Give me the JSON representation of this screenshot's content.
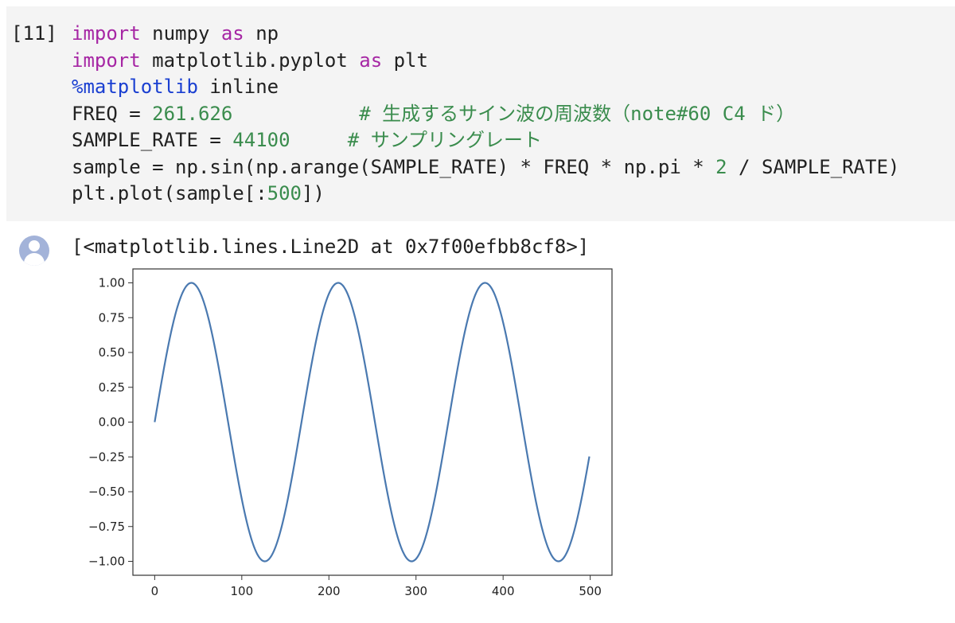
{
  "cell": {
    "execution_count": "[11]",
    "code_lines": [
      [
        {
          "t": "import",
          "c": "kw"
        },
        {
          "t": " numpy "
        },
        {
          "t": "as",
          "c": "kw"
        },
        {
          "t": " np"
        }
      ],
      [
        {
          "t": "import",
          "c": "kw"
        },
        {
          "t": " matplotlib.pyplot "
        },
        {
          "t": "as",
          "c": "kw"
        },
        {
          "t": " plt"
        }
      ],
      [
        {
          "t": "%matplotlib",
          "c": "magic"
        },
        {
          "t": " inline"
        }
      ],
      [
        {
          "t": "FREQ = "
        },
        {
          "t": "261.626",
          "c": "num"
        },
        {
          "t": "           "
        },
        {
          "t": "# 生成するサイン波の周波数（note#60 C4 ド）",
          "c": "cmt"
        }
      ],
      [
        {
          "t": "SAMPLE_RATE = "
        },
        {
          "t": "44100",
          "c": "num"
        },
        {
          "t": "     "
        },
        {
          "t": "# サンプリングレート",
          "c": "cmt"
        }
      ],
      [
        {
          "t": "sample = np.sin(np.arange(SAMPLE_RATE) * FREQ * np.pi * "
        },
        {
          "t": "2",
          "c": "num"
        },
        {
          "t": " / SAMPLE_RATE)"
        }
      ],
      [
        {
          "t": "plt.plot(sample[:"
        },
        {
          "t": "500",
          "c": "num"
        },
        {
          "t": "])"
        }
      ]
    ]
  },
  "output": {
    "text": "[<matplotlib.lines.Line2D at 0x7f00efbb8cf8>]"
  },
  "colors": {
    "line": "#4a79b0",
    "keyword": "#a626a4",
    "magic": "#1a3fd1",
    "number": "#3a8c4d"
  },
  "chart_data": {
    "type": "line",
    "x_ticks": [
      "0",
      "100",
      "200",
      "300",
      "400",
      "500"
    ],
    "y_ticks": [
      "1.00",
      "0.75",
      "0.50",
      "0.25",
      "0.00",
      "−0.25",
      "−0.50",
      "−0.75",
      "−1.00"
    ],
    "xlim": [
      -25,
      525
    ],
    "ylim": [
      -1.1,
      1.1
    ],
    "series": [
      {
        "function": "sin(x * 261.626 * 2π / 44100)",
        "x_range": [
          0,
          499
        ],
        "freq": 261.626,
        "sample_rate": 44100
      }
    ],
    "grid": false
  }
}
